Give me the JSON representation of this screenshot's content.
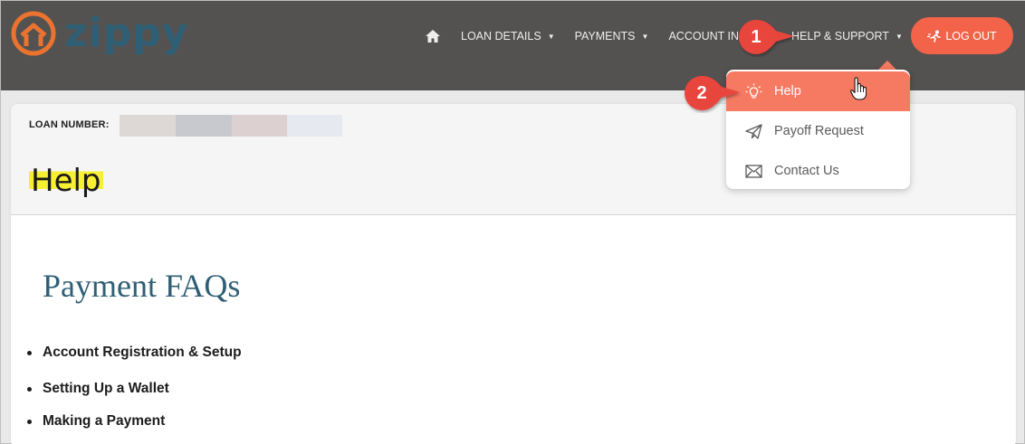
{
  "brand": {
    "logo_text": "zippy",
    "logo_color": "#2f5f74",
    "ring_color": "#e9732f"
  },
  "nav": {
    "home_icon": "home-icon",
    "items": [
      {
        "label": "LOAN DETAILS"
      },
      {
        "label": "PAYMENTS"
      },
      {
        "label": "ACCOUNT IN"
      },
      {
        "label": "HELP & SUPPORT"
      }
    ],
    "logout_label": "LOG OUT",
    "logout_color": "#f2634a"
  },
  "dropdown": {
    "items": [
      {
        "label": "Help",
        "icon": "lightbulb-icon",
        "active": true
      },
      {
        "label": "Payoff Request",
        "icon": "paper-plane-icon"
      },
      {
        "label": "Contact Us",
        "icon": "envelope-icon"
      }
    ],
    "active_color": "#f67a61"
  },
  "loan": {
    "label": "LOAN NUMBER:"
  },
  "page": {
    "title": "Help",
    "section_title": "Payment FAQs",
    "faqs": [
      "Account Registration & Setup",
      "Setting Up a Wallet",
      "Making a Payment"
    ]
  },
  "callouts": [
    {
      "number": "1",
      "color": "#e8453c"
    },
    {
      "number": "2",
      "color": "#e8453c"
    }
  ]
}
